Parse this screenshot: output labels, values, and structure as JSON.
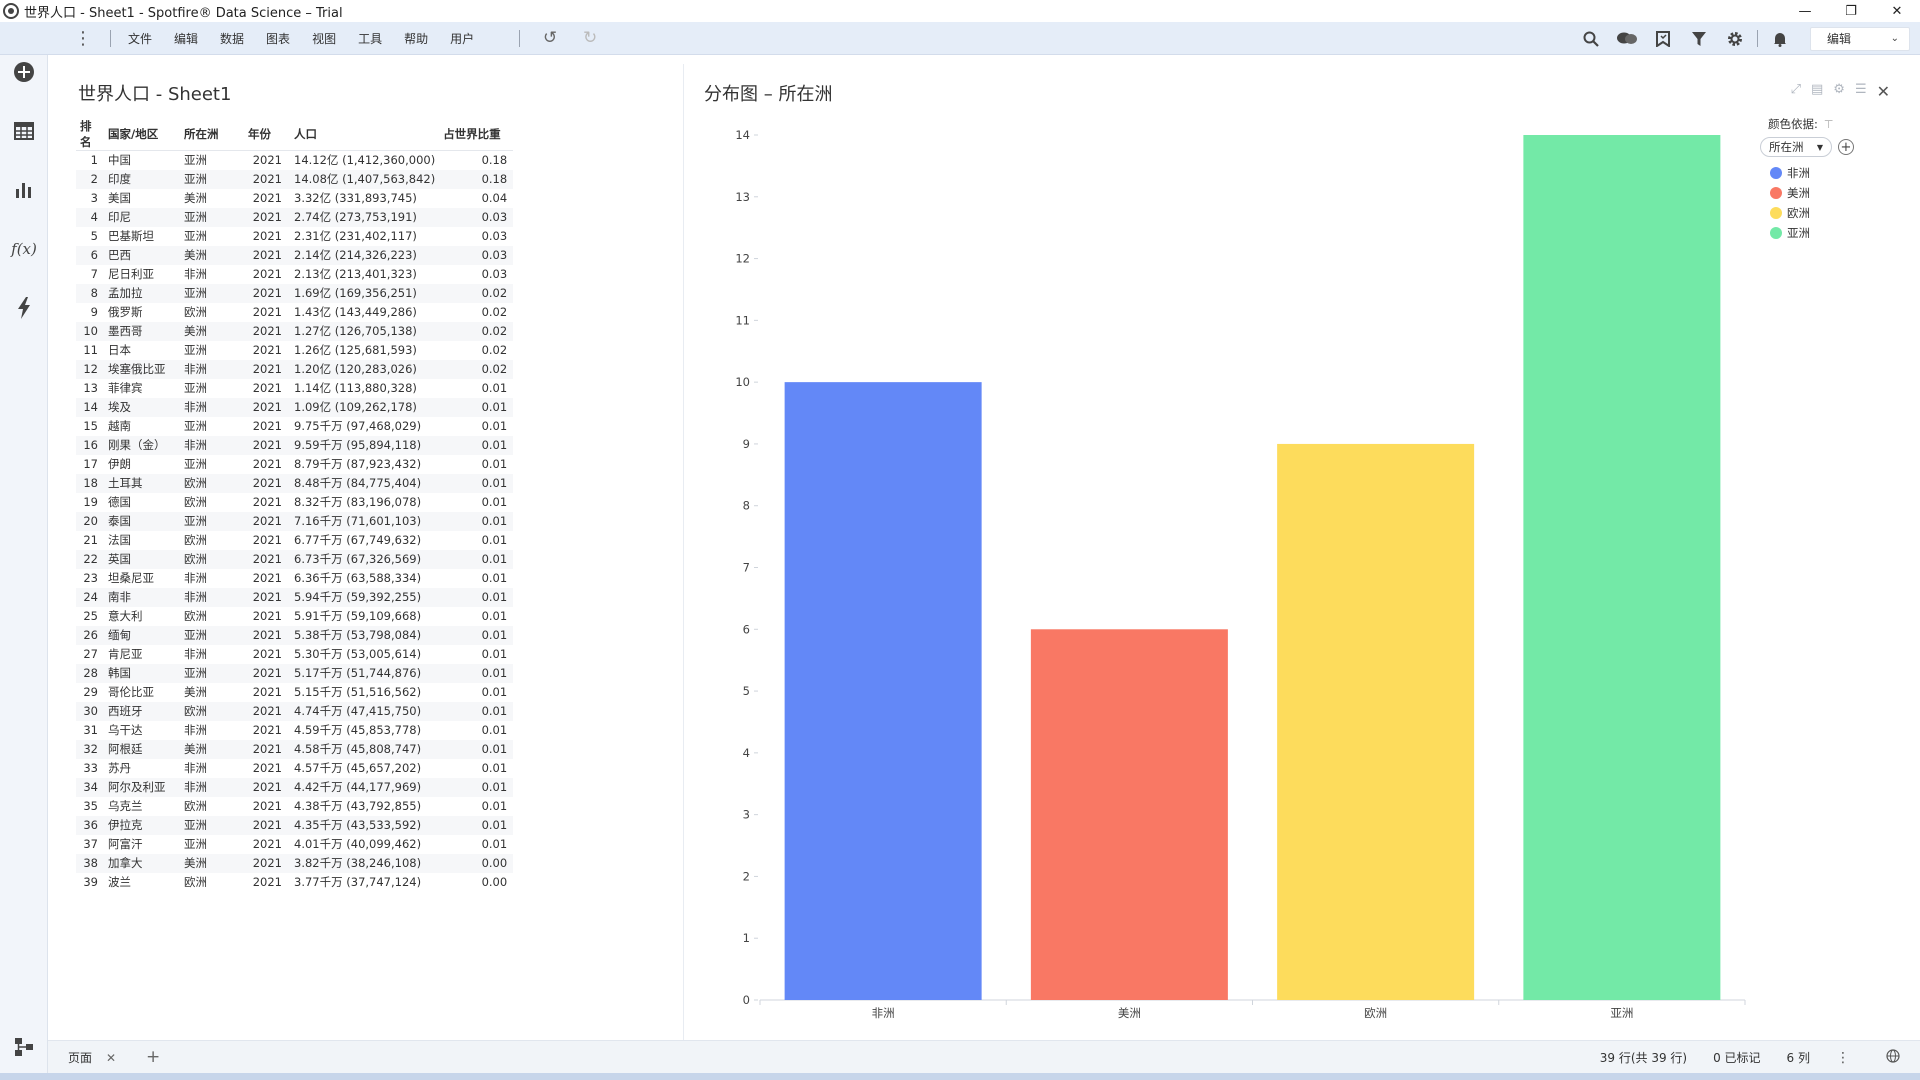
{
  "window": {
    "title": "世界人口 - Sheet1 - Spotfire® Data Science – Trial",
    "min_label": "—",
    "max_label": "❐",
    "close_label": "✕"
  },
  "toolbar": {
    "menu": [
      "文件",
      "编辑",
      "数据",
      "图表",
      "视图",
      "工具",
      "帮助",
      "用户"
    ],
    "mode_value": "编辑"
  },
  "table": {
    "title": "世界人口 - Sheet1",
    "columns": [
      "排名",
      "国家/地区",
      "所在洲",
      "年份",
      "人口",
      "占世界比重"
    ],
    "rows": [
      [
        "1",
        "中国",
        "亚洲",
        "2021",
        "14.12亿 (1,412,360,000)",
        "0.18"
      ],
      [
        "2",
        "印度",
        "亚洲",
        "2021",
        "14.08亿 (1,407,563,842)",
        "0.18"
      ],
      [
        "3",
        "美国",
        "美洲",
        "2021",
        "3.32亿 (331,893,745)",
        "0.04"
      ],
      [
        "4",
        "印尼",
        "亚洲",
        "2021",
        "2.74亿 (273,753,191)",
        "0.03"
      ],
      [
        "5",
        "巴基斯坦",
        "亚洲",
        "2021",
        "2.31亿 (231,402,117)",
        "0.03"
      ],
      [
        "6",
        "巴西",
        "美洲",
        "2021",
        "2.14亿 (214,326,223)",
        "0.03"
      ],
      [
        "7",
        "尼日利亚",
        "非洲",
        "2021",
        "2.13亿 (213,401,323)",
        "0.03"
      ],
      [
        "8",
        "孟加拉",
        "亚洲",
        "2021",
        "1.69亿 (169,356,251)",
        "0.02"
      ],
      [
        "9",
        "俄罗斯",
        "欧洲",
        "2021",
        "1.43亿 (143,449,286)",
        "0.02"
      ],
      [
        "10",
        "墨西哥",
        "美洲",
        "2021",
        "1.27亿 (126,705,138)",
        "0.02"
      ],
      [
        "11",
        "日本",
        "亚洲",
        "2021",
        "1.26亿 (125,681,593)",
        "0.02"
      ],
      [
        "12",
        "埃塞俄比亚",
        "非洲",
        "2021",
        "1.20亿 (120,283,026)",
        "0.02"
      ],
      [
        "13",
        "菲律宾",
        "亚洲",
        "2021",
        "1.14亿 (113,880,328)",
        "0.01"
      ],
      [
        "14",
        "埃及",
        "非洲",
        "2021",
        "1.09亿 (109,262,178)",
        "0.01"
      ],
      [
        "15",
        "越南",
        "亚洲",
        "2021",
        "9.75千万 (97,468,029)",
        "0.01"
      ],
      [
        "16",
        "刚果（金）",
        "非洲",
        "2021",
        "9.59千万 (95,894,118)",
        "0.01"
      ],
      [
        "17",
        "伊朗",
        "亚洲",
        "2021",
        "8.79千万 (87,923,432)",
        "0.01"
      ],
      [
        "18",
        "土耳其",
        "欧洲",
        "2021",
        "8.48千万 (84,775,404)",
        "0.01"
      ],
      [
        "19",
        "德国",
        "欧洲",
        "2021",
        "8.32千万 (83,196,078)",
        "0.01"
      ],
      [
        "20",
        "泰国",
        "亚洲",
        "2021",
        "7.16千万 (71,601,103)",
        "0.01"
      ],
      [
        "21",
        "法国",
        "欧洲",
        "2021",
        "6.77千万 (67,749,632)",
        "0.01"
      ],
      [
        "22",
        "英国",
        "欧洲",
        "2021",
        "6.73千万 (67,326,569)",
        "0.01"
      ],
      [
        "23",
        "坦桑尼亚",
        "非洲",
        "2021",
        "6.36千万 (63,588,334)",
        "0.01"
      ],
      [
        "24",
        "南非",
        "非洲",
        "2021",
        "5.94千万 (59,392,255)",
        "0.01"
      ],
      [
        "25",
        "意大利",
        "欧洲",
        "2021",
        "5.91千万 (59,109,668)",
        "0.01"
      ],
      [
        "26",
        "缅甸",
        "亚洲",
        "2021",
        "5.38千万 (53,798,084)",
        "0.01"
      ],
      [
        "27",
        "肯尼亚",
        "非洲",
        "2021",
        "5.30千万 (53,005,614)",
        "0.01"
      ],
      [
        "28",
        "韩国",
        "亚洲",
        "2021",
        "5.17千万 (51,744,876)",
        "0.01"
      ],
      [
        "29",
        "哥伦比亚",
        "美洲",
        "2021",
        "5.15千万 (51,516,562)",
        "0.01"
      ],
      [
        "30",
        "西班牙",
        "欧洲",
        "2021",
        "4.74千万 (47,415,750)",
        "0.01"
      ],
      [
        "31",
        "乌干达",
        "非洲",
        "2021",
        "4.59千万 (45,853,778)",
        "0.01"
      ],
      [
        "32",
        "阿根廷",
        "美洲",
        "2021",
        "4.58千万 (45,808,747)",
        "0.01"
      ],
      [
        "33",
        "苏丹",
        "非洲",
        "2021",
        "4.57千万 (45,657,202)",
        "0.01"
      ],
      [
        "34",
        "阿尔及利亚",
        "非洲",
        "2021",
        "4.42千万 (44,177,969)",
        "0.01"
      ],
      [
        "35",
        "乌克兰",
        "欧洲",
        "2021",
        "4.38千万 (43,792,855)",
        "0.01"
      ],
      [
        "36",
        "伊拉克",
        "亚洲",
        "2021",
        "4.35千万 (43,533,592)",
        "0.01"
      ],
      [
        "37",
        "阿富汗",
        "亚洲",
        "2021",
        "4.01千万 (40,099,462)",
        "0.01"
      ],
      [
        "38",
        "加拿大",
        "美洲",
        "2021",
        "3.82千万 (38,246,108)",
        "0.00"
      ],
      [
        "39",
        "波兰",
        "欧洲",
        "2021",
        "3.77千万 (37,747,124)",
        "0.00"
      ]
    ]
  },
  "chart": {
    "title": "分布图 – 所在洲",
    "legend_title": "颜色依据:",
    "legend_select": "所在洲",
    "legend_items": [
      {
        "label": "非洲",
        "color": "#6388f7"
      },
      {
        "label": "美洲",
        "color": "#f97864"
      },
      {
        "label": "欧洲",
        "color": "#fddc5c"
      },
      {
        "label": "亚洲",
        "color": "#73e9a7"
      }
    ]
  },
  "chart_data": {
    "type": "bar",
    "categories": [
      "非洲",
      "美洲",
      "欧洲",
      "亚洲"
    ],
    "values": [
      10,
      6,
      9,
      14
    ],
    "colors": [
      "#6388f7",
      "#f97864",
      "#fddc5c",
      "#73e9a7"
    ],
    "title": "分布图 – 所在洲",
    "xlabel": "",
    "ylabel": "",
    "ylim": [
      0,
      14
    ],
    "yticks": [
      0,
      1,
      2,
      3,
      4,
      5,
      6,
      7,
      8,
      9,
      10,
      11,
      12,
      13,
      14
    ],
    "grid": false,
    "legend": "top-right"
  },
  "bottombar": {
    "page_tab": "页面",
    "status_rows": "39 行(共 39 行)",
    "status_marked": "0 已标记",
    "status_cols": "6 列"
  }
}
